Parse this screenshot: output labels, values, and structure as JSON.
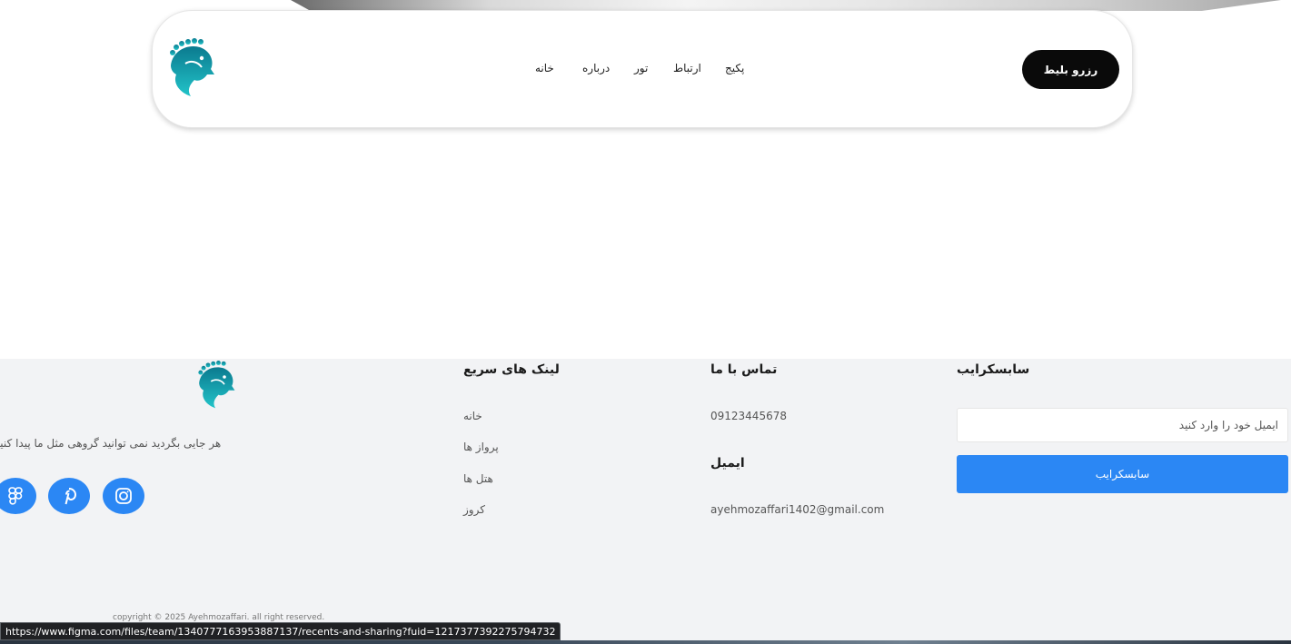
{
  "header": {
    "nav": [
      {
        "label": "خانه"
      },
      {
        "label": "درباره"
      },
      {
        "label": "تور"
      },
      {
        "label": "ارتباط"
      },
      {
        "label": "پکیج"
      }
    ],
    "cta_label": "رزرو بلیط"
  },
  "footer": {
    "tagline": "هر جایی بگردید نمی توانید گروهی مثل ما پیدا کنید",
    "quick_links": {
      "title": "لینک های سریع",
      "items": [
        {
          "label": "خانه"
        },
        {
          "label": "پرواز ها"
        },
        {
          "label": "هتل ها"
        },
        {
          "label": "کروز"
        }
      ]
    },
    "contact": {
      "title": "تماس با ما",
      "phone": "09123445678",
      "email_title": "ایمیل",
      "email": "ayehmozaffari1402@gmail.com"
    },
    "subscribe": {
      "title": "سابسکرایب",
      "placeholder": "ایمیل خود را وارد کنید",
      "button_label": "سابسکرایب"
    },
    "copyright": "copyright © 2025 Ayehmozaffari. all right reserved.",
    "social_icons": [
      "figma-icon",
      "pinterest-icon",
      "instagram-icon"
    ]
  },
  "status_bar": {
    "url": "https://www.figma.com/files/team/1340777163953887137/recents-and-sharing?fuid=1217377392275794732"
  },
  "colors": {
    "accent": "#2b87f4",
    "cta": "#0a0a0a",
    "footer_bg": "#f2f3f5",
    "logo_teal": "#1aa3b5"
  }
}
